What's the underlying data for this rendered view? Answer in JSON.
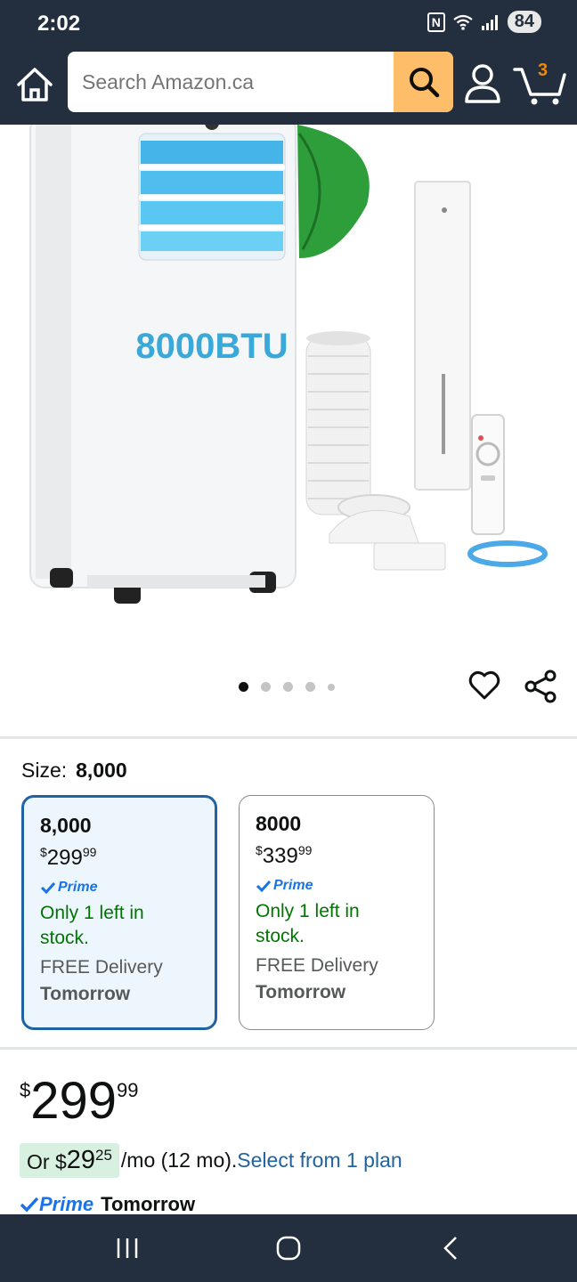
{
  "status": {
    "time": "2:02",
    "battery": "84",
    "nfc": "N"
  },
  "nav": {
    "search_placeholder": "Search Amazon.ca",
    "cart_count": "3"
  },
  "product": {
    "image_label": "8000BTU",
    "gallery_dots": 5,
    "gallery_active_index": 0
  },
  "size": {
    "label": "Size:",
    "selected_value": "8,000",
    "options": [
      {
        "title": "8,000",
        "currency": "$",
        "price_whole": "299",
        "price_fraction": "99",
        "prime": "Prime",
        "stock_line1": "Only 1 left in",
        "stock_line2": "stock.",
        "delivery": "FREE Delivery",
        "delivery_day": "Tomorrow"
      },
      {
        "title": "8000",
        "currency": "$",
        "price_whole": "339",
        "price_fraction": "99",
        "prime": "Prime",
        "stock_line1": "Only 1 left in",
        "stock_line2": "stock.",
        "delivery": "FREE Delivery",
        "delivery_day": "Tomorrow"
      }
    ]
  },
  "price": {
    "currency": "$",
    "whole": "299",
    "fraction": "99"
  },
  "monthly": {
    "prefix": "Or $",
    "amount": "29",
    "fraction": "25",
    "suffix": "/mo (12 mo).",
    "link": "Select from 1 plan"
  },
  "delivery": {
    "prime": "Prime",
    "day": "Tomorrow"
  },
  "colors": {
    "header_bg": "#232f3e",
    "search_button": "#febd69",
    "cart_count": "#f08804",
    "selected_border": "#2162a1",
    "stock_green": "#007600",
    "prime_blue": "#1a73e8",
    "monthly_bg": "#d7f0e0"
  }
}
